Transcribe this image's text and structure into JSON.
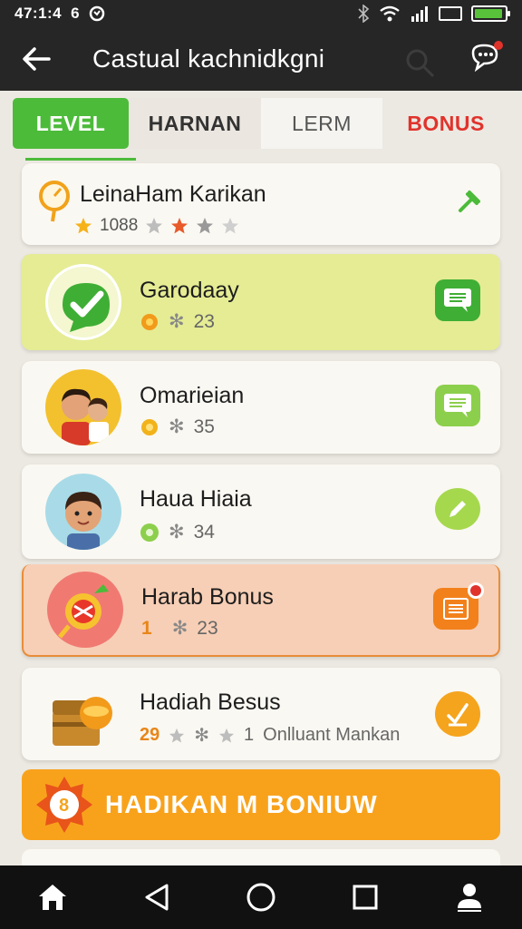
{
  "status_bar": {
    "time": "47:1:4",
    "extra": "6",
    "battery_level": 0.95,
    "icons": [
      "sync-icon",
      "bluetooth-icon",
      "wifi-icon",
      "signal-icon",
      "window-icon",
      "battery-icon"
    ]
  },
  "app_bar": {
    "title": "Castual kachnidkgni",
    "icons": [
      "back-arrow-icon",
      "search-icon",
      "chat-bubble-icon"
    ]
  },
  "tabs": [
    {
      "label": "LEVEL",
      "active": true
    },
    {
      "label": "HARNAN",
      "active": false
    },
    {
      "label": "LERM",
      "active": false
    },
    {
      "label": "BONUS",
      "active": false
    }
  ],
  "header_card": {
    "title": "LeinaHam Karikan",
    "score": "1088",
    "icons": [
      "stopwatch-icon",
      "star-icon",
      "hammer-icon"
    ]
  },
  "items": [
    {
      "name": "Garodaay",
      "count": "23",
      "icon": "checkmark-chat-icon",
      "action_icon": "message-icon"
    },
    {
      "name": "Omarieian",
      "count": "35",
      "icon": "avatar-pair-icon",
      "action_icon": "message-icon"
    },
    {
      "name": "Haua Hiaia",
      "count": "34",
      "icon": "avatar-boy-icon",
      "action_icon": "pencil-icon"
    },
    {
      "name": "Harab Bonus",
      "prefix": "1",
      "count": "23",
      "icon": "candy-icon",
      "action_icon": "message-icon"
    },
    {
      "name": "Hadiah Besus",
      "prefix": "29",
      "count": "1",
      "extra": "Onlluant Mankan",
      "icon": "treasure-chest-icon",
      "action_icon": "sword-check-icon"
    }
  ],
  "banner": {
    "label": "HADIKAN  M BONIUW",
    "badge_number": "8"
  },
  "colors": {
    "accent_green": "#4cbb3a",
    "bonus_red": "#e0332c",
    "banner_orange": "#f8a21c",
    "highlight_yellow": "#e5ec94",
    "highlight_peach": "#f7cfb6"
  },
  "nav": [
    "home-icon",
    "back-triangle-icon",
    "home-circle-icon",
    "recents-square-icon",
    "profile-icon"
  ]
}
